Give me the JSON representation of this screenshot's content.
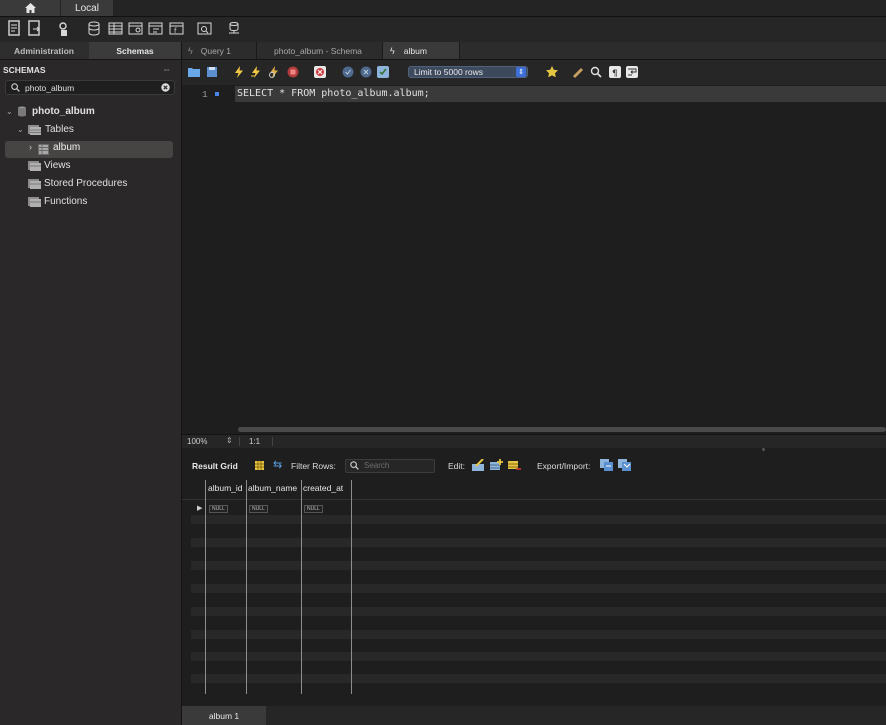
{
  "top_tabs": {
    "local_label": "Local"
  },
  "sidebar": {
    "tab_admin": "Administration",
    "tab_schemas": "Schemas",
    "header": "SCHEMAS",
    "search_value": "photo_album",
    "tree": {
      "schema": "photo_album",
      "tables": "Tables",
      "album": "album",
      "views": "Views",
      "procedures": "Stored Procedures",
      "functions": "Functions"
    }
  },
  "editor_tabs": [
    {
      "label": "Query 1"
    },
    {
      "label": "photo_album - Schema"
    },
    {
      "label": "album"
    }
  ],
  "sql_toolbar": {
    "limit_label": "Limit to 5000 rows"
  },
  "editor": {
    "line_number": "1",
    "sql": "SELECT * FROM photo_album.album;"
  },
  "editor_status": {
    "zoom": "100%",
    "position": "1:1"
  },
  "result_toolbar": {
    "title": "Result Grid",
    "filter_label": "Filter Rows:",
    "filter_placeholder": "Search",
    "edit_label": "Edit:",
    "export_label": "Export/Import:"
  },
  "result_grid": {
    "columns": [
      "album_id",
      "album_name",
      "created_at"
    ],
    "null_text": "NULL"
  },
  "bottom_tabs": {
    "result_tab": "album 1"
  },
  "colors": {
    "accent_blue": "#3e6fd8",
    "selection": "#474544"
  }
}
